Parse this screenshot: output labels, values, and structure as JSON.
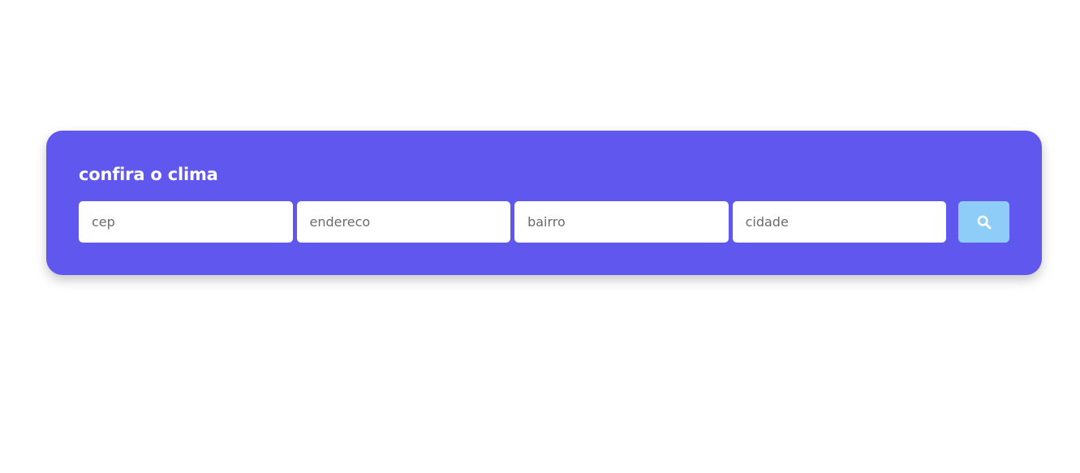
{
  "card": {
    "title": "confira o clima"
  },
  "fields": {
    "cep_placeholder": "cep",
    "endereco_placeholder": "endereco",
    "bairro_placeholder": "bairro",
    "cidade_placeholder": "cidade"
  },
  "search_button": {
    "icon": "search-icon"
  },
  "colors": {
    "card_background": "#5f57ee",
    "button_background": "#8dcdf8",
    "text_on_card": "#ffffff"
  }
}
